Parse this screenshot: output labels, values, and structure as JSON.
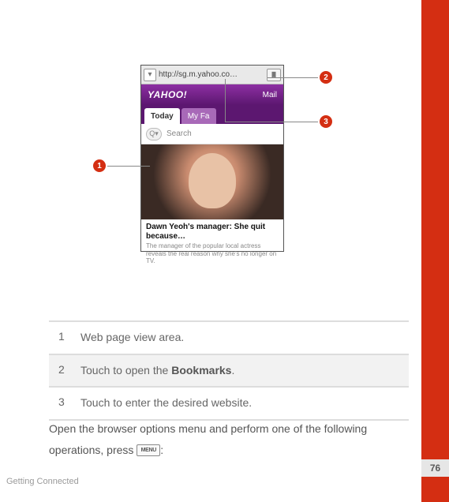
{
  "page_number": "76",
  "footer_section": "Getting Connected",
  "screenshot": {
    "url_text": "http://sg.m.yahoo.co…",
    "brand_logo": "YAHOO!",
    "header_right": "Mail",
    "tabs": {
      "active": "Today",
      "inactive": "My Fa"
    },
    "search_placeholder": "Search",
    "article_title": "Dawn Yeoh's manager: She quit because…",
    "article_subtitle": "The manager of the popular local actress reveals the real reason why she's no longer on TV."
  },
  "callouts": {
    "n1": "1",
    "n2": "2",
    "n3": "3"
  },
  "legend": {
    "r1": {
      "num": "1",
      "text": "Web page view area."
    },
    "r2": {
      "num": "2",
      "pre": "Touch to open the ",
      "bold": "Bookmarks",
      "post": "."
    },
    "r3": {
      "num": "3",
      "text": "Touch to enter the desired website."
    }
  },
  "body": {
    "line1": "Open the browser options menu and perform one of the following",
    "line2_pre": "operations, press ",
    "menu_label": "MENU",
    "line2_post": ":"
  }
}
